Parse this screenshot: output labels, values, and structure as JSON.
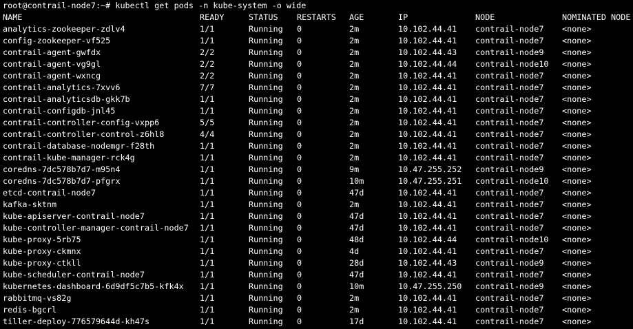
{
  "terminal": {
    "prompt": "root@contrail-node7:~# kubectl get pods -n kube-system -o wide",
    "colors": {
      "background": "#000000",
      "foreground": "#ffffff"
    },
    "headers": [
      "NAME",
      "READY",
      "STATUS",
      "RESTARTS",
      "AGE",
      "IP",
      "NODE",
      "NOMINATED NODE"
    ],
    "rows": [
      [
        "analytics-zookeeper-zdlv4",
        "1/1",
        "Running",
        "0",
        "2m",
        "10.102.44.41",
        "contrail-node7",
        "<none>"
      ],
      [
        "config-zookeeper-vf525",
        "1/1",
        "Running",
        "0",
        "2m",
        "10.102.44.41",
        "contrail-node7",
        "<none>"
      ],
      [
        "contrail-agent-gwfdx",
        "2/2",
        "Running",
        "0",
        "2m",
        "10.102.44.43",
        "contrail-node9",
        "<none>"
      ],
      [
        "contrail-agent-vg9gl",
        "2/2",
        "Running",
        "0",
        "2m",
        "10.102.44.44",
        "contrail-node10",
        "<none>"
      ],
      [
        "contrail-agent-wxncg",
        "2/2",
        "Running",
        "0",
        "2m",
        "10.102.44.41",
        "contrail-node7",
        "<none>"
      ],
      [
        "contrail-analytics-7xvv6",
        "7/7",
        "Running",
        "0",
        "2m",
        "10.102.44.41",
        "contrail-node7",
        "<none>"
      ],
      [
        "contrail-analyticsdb-gkk7b",
        "1/1",
        "Running",
        "0",
        "2m",
        "10.102.44.41",
        "contrail-node7",
        "<none>"
      ],
      [
        "contrail-configdb-jnl45",
        "1/1",
        "Running",
        "0",
        "2m",
        "10.102.44.41",
        "contrail-node7",
        "<none>"
      ],
      [
        "contrail-controller-config-vxpp6",
        "5/5",
        "Running",
        "0",
        "2m",
        "10.102.44.41",
        "contrail-node7",
        "<none>"
      ],
      [
        "contrail-controller-control-z6hl8",
        "4/4",
        "Running",
        "0",
        "2m",
        "10.102.44.41",
        "contrail-node7",
        "<none>"
      ],
      [
        "contrail-database-nodemgr-f28th",
        "1/1",
        "Running",
        "0",
        "2m",
        "10.102.44.41",
        "contrail-node7",
        "<none>"
      ],
      [
        "contrail-kube-manager-rck4g",
        "1/1",
        "Running",
        "0",
        "2m",
        "10.102.44.41",
        "contrail-node7",
        "<none>"
      ],
      [
        "coredns-7dc578b7d7-m95n4",
        "1/1",
        "Running",
        "0",
        "9m",
        "10.47.255.252",
        "contrail-node9",
        "<none>"
      ],
      [
        "coredns-7dc578b7d7-pfgrx",
        "1/1",
        "Running",
        "0",
        "10m",
        "10.47.255.251",
        "contrail-node10",
        "<none>"
      ],
      [
        "etcd-contrail-node7",
        "1/1",
        "Running",
        "0",
        "47d",
        "10.102.44.41",
        "contrail-node7",
        "<none>"
      ],
      [
        "kafka-sktnm",
        "1/1",
        "Running",
        "0",
        "2m",
        "10.102.44.41",
        "contrail-node7",
        "<none>"
      ],
      [
        "kube-apiserver-contrail-node7",
        "1/1",
        "Running",
        "0",
        "47d",
        "10.102.44.41",
        "contrail-node7",
        "<none>"
      ],
      [
        "kube-controller-manager-contrail-node7",
        "1/1",
        "Running",
        "0",
        "47d",
        "10.102.44.41",
        "contrail-node7",
        "<none>"
      ],
      [
        "kube-proxy-5rb75",
        "1/1",
        "Running",
        "0",
        "48d",
        "10.102.44.44",
        "contrail-node10",
        "<none>"
      ],
      [
        "kube-proxy-ckmnx",
        "1/1",
        "Running",
        "0",
        "4d",
        "10.102.44.41",
        "contrail-node7",
        "<none>"
      ],
      [
        "kube-proxy-ctkll",
        "1/1",
        "Running",
        "0",
        "28d",
        "10.102.44.43",
        "contrail-node9",
        "<none>"
      ],
      [
        "kube-scheduler-contrail-node7",
        "1/1",
        "Running",
        "0",
        "47d",
        "10.102.44.41",
        "contrail-node7",
        "<none>"
      ],
      [
        "kubernetes-dashboard-6d9df5c7b5-kfk4x",
        "1/1",
        "Running",
        "0",
        "10m",
        "10.47.255.250",
        "contrail-node9",
        "<none>"
      ],
      [
        "rabbitmq-vs82g",
        "1/1",
        "Running",
        "0",
        "2m",
        "10.102.44.41",
        "contrail-node7",
        "<none>"
      ],
      [
        "redis-bgcrl",
        "1/1",
        "Running",
        "0",
        "2m",
        "10.102.44.41",
        "contrail-node7",
        "<none>"
      ],
      [
        "tiller-deploy-776579644d-kh47s",
        "1/1",
        "Running",
        "0",
        "17d",
        "10.102.44.41",
        "contrail-node7",
        "<none>"
      ]
    ]
  }
}
